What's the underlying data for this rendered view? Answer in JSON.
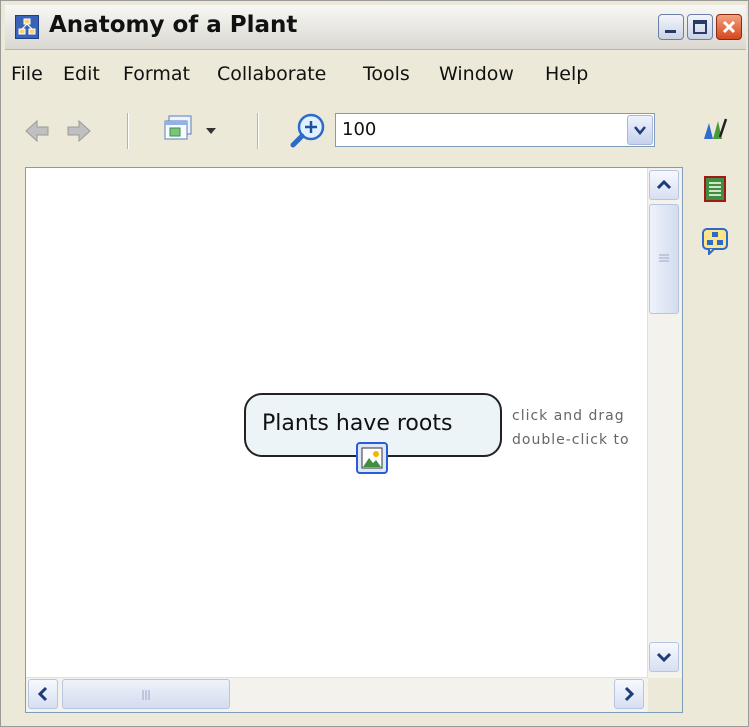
{
  "window": {
    "title": "Anatomy of a Plant"
  },
  "menu": [
    "File",
    "Edit",
    "Format",
    "Collaborate",
    "Tools",
    "Window",
    "Help"
  ],
  "toolbar": {
    "zoom_value": "100"
  },
  "map": {
    "concept_label": "Plants have roots",
    "hint_line1": "click and drag",
    "hint_line2": "double-click to"
  },
  "icons": {
    "app": "concept-map-icon",
    "back": "back-arrow-icon",
    "forward": "forward-arrow-icon",
    "views": "views-dropdown-icon",
    "zoom": "zoom-in-icon",
    "styles": "styles-palette-icon",
    "list": "list-view-icon",
    "outline": "outline-view-icon",
    "image": "image-resource-icon"
  },
  "colors": {
    "title_bar": "#dad8d0",
    "close": "#d5461e",
    "canvas": "#ffffff",
    "concept_fill": "#ecf4f8"
  }
}
